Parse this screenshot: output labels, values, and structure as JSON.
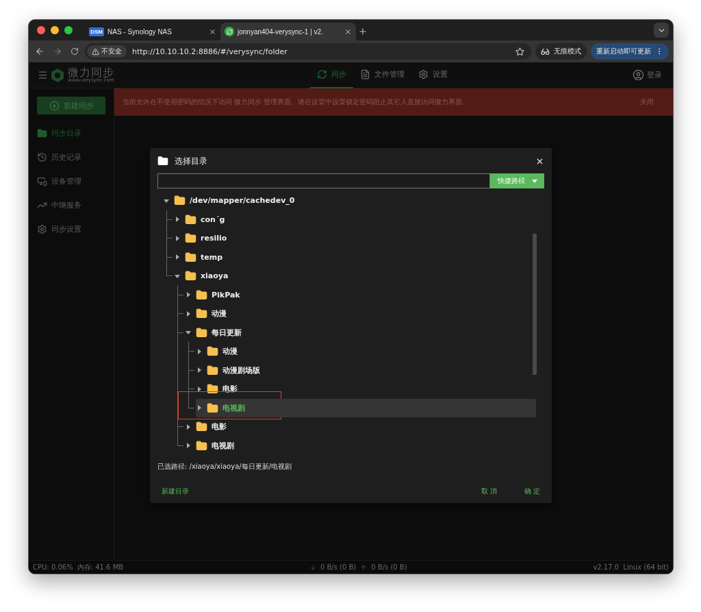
{
  "browser": {
    "tabs": [
      {
        "title": "NAS - Synology NAS",
        "favicon": "DSM",
        "selected": false
      },
      {
        "title": "jonnyan404-verysync-1 | v2.",
        "selected": true
      }
    ],
    "security_label": "不安全",
    "url": "http://10.10.10.2:8886/#/verysync/folder",
    "incognito_label": "无痕模式",
    "update_label": "重新启动即可更新"
  },
  "header": {
    "logo": "微力同步",
    "logo_subtitle": "www.verysync.com",
    "nav": [
      {
        "label": "同步",
        "kind": "sync",
        "selected": true
      },
      {
        "label": "文件管理",
        "kind": "files",
        "selected": false
      },
      {
        "label": "设置",
        "kind": "settings",
        "selected": false
      }
    ],
    "login": "登录"
  },
  "sidebar": {
    "new_button": "新建同步",
    "items": [
      {
        "label": "同步目录",
        "kind": "folder",
        "selected": true
      },
      {
        "label": "历史记录",
        "kind": "history",
        "selected": false
      },
      {
        "label": "设备管理",
        "kind": "devices",
        "selected": false
      },
      {
        "label": "中继服务",
        "kind": "relay",
        "selected": false
      },
      {
        "label": "同步设置",
        "kind": "settings",
        "selected": false
      }
    ]
  },
  "banner": {
    "message": "当前允许在不使用密码的情况下访问 微力同步 管理界面。请在设置中设置锁定密码阻止其它人直接访问微力界面。",
    "close": "关闭"
  },
  "dialog": {
    "title": "选择目录",
    "shortcut_button": "快捷路径",
    "tree": {
      "label": "/dev/mapper/cachedev_0",
      "expanded": true,
      "selected": false,
      "children": [
        {
          "label": "con´g",
          "expanded": false,
          "selected": false
        },
        {
          "label": "resilio",
          "expanded": false,
          "selected": false
        },
        {
          "label": "temp",
          "expanded": false,
          "selected": false
        },
        {
          "label": "xiaoya",
          "expanded": true,
          "selected": false,
          "children": [
            {
              "label": "PikPak",
              "expanded": false,
              "selected": false
            },
            {
              "label": "动漫",
              "expanded": false,
              "selected": false
            },
            {
              "label": "每日更新",
              "expanded": true,
              "selected": false,
              "children": [
                {
                  "label": "动漫",
                  "expanded": false,
                  "selected": false
                },
                {
                  "label": "动漫剧场版",
                  "expanded": false,
                  "selected": false
                },
                {
                  "label": "电影",
                  "expanded": false,
                  "selected": false
                },
                {
                  "label": "电视剧",
                  "expanded": false,
                  "selected": true,
                  "outlined": true
                }
              ]
            },
            {
              "label": "电影",
              "expanded": false,
              "selected": false
            },
            {
              "label": "电视剧",
              "expanded": false,
              "selected": false
            }
          ]
        }
      ]
    },
    "selected_path": "已选路径: /xiaoya/xiaoya/每日更新/电视剧",
    "new_folder": "新建目录",
    "cancel": "取 消",
    "confirm": "确 定"
  },
  "status_bar": {
    "cpu": "CPU: 0.06%",
    "memory": "内存: 41.6 MB",
    "download": "0 B/s (0 B)",
    "upload": "0 B/s (0 B)",
    "version": "v2.17.0",
    "platform": "Linux (64 bit)"
  }
}
